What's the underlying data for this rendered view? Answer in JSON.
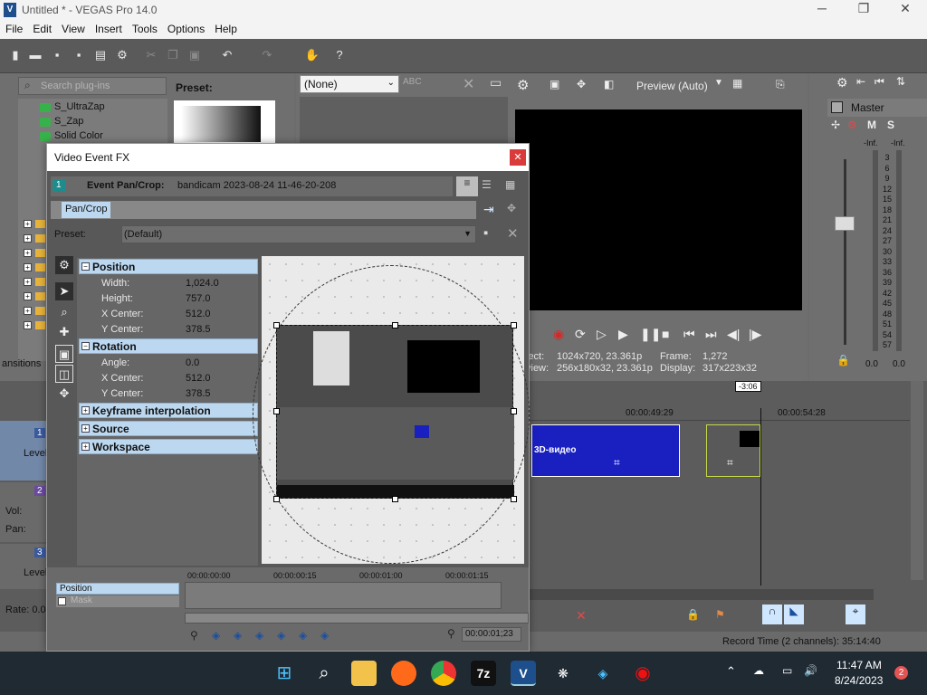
{
  "window": {
    "title": "Untitled * - VEGAS Pro 14.0"
  },
  "menu": [
    "File",
    "Edit",
    "View",
    "Insert",
    "Tools",
    "Options",
    "Help"
  ],
  "plugins": {
    "search_placeholder": "Search plug-ins",
    "preset_label": "Preset:",
    "items": [
      "S_UltraZap",
      "S_Zap",
      "Solid Color"
    ],
    "transitions_tab": "ansitions"
  },
  "fx_preset": {
    "value": "(None)"
  },
  "preview": {
    "mode": "Preview (Auto)",
    "project_label": "ject:",
    "project_value": "1024x720, 23.361p",
    "preview_label": "view:",
    "preview_value": "256x180x32, 23.361p",
    "frame_label": "Frame:",
    "frame_value": "1,272",
    "display_label": "Display:",
    "display_value": "317x223x32"
  },
  "mixer": {
    "title": "Master",
    "left_db": "-Inf.",
    "right_db": "-Inf.",
    "scale": [
      "3",
      "6",
      "9",
      "12",
      "15",
      "18",
      "21",
      "24",
      "27",
      "30",
      "33",
      "36",
      "39",
      "42",
      "45",
      "48",
      "51",
      "54",
      "57"
    ],
    "left_level": "0.0",
    "right_level": "0.0"
  },
  "dialog": {
    "title": "Video Event FX",
    "chain_num": "1",
    "event_label": "Event Pan/Crop:",
    "event_name": "bandicam 2023-08-24 11-46-20-208",
    "tab": "Pan/Crop",
    "preset_label": "Preset:",
    "preset_value": "(Default)",
    "sections": {
      "position": "Position",
      "rotation": "Rotation",
      "keyframe": "Keyframe interpolation",
      "source": "Source",
      "workspace": "Workspace"
    },
    "position_rows": [
      {
        "k": "Width:",
        "v": "1,024.0"
      },
      {
        "k": "Height:",
        "v": "757.0"
      },
      {
        "k": "X Center:",
        "v": "512.0"
      },
      {
        "k": "Y Center:",
        "v": "378.5"
      }
    ],
    "rotation_rows": [
      {
        "k": "Angle:",
        "v": "0.0"
      },
      {
        "k": "X Center:",
        "v": "512.0"
      },
      {
        "k": "Y Center:",
        "v": "378.5"
      }
    ],
    "keyframes": {
      "track_position": "Position",
      "track_mask": "Mask",
      "ticks": [
        "00:00:00:00",
        "00:00:00:15",
        "00:00:01:00",
        "00:00:01:15"
      ],
      "cursor_time": "00:00:01;23"
    }
  },
  "timeline": {
    "cursor": "-3:06",
    "ruler": [
      "00:00:49:29",
      "00:00:54:28"
    ],
    "tracks": [
      {
        "num": "1",
        "label": "Level"
      },
      {
        "num": "2",
        "vol": "Vol:",
        "pan": "Pan:"
      },
      {
        "num": "3",
        "label": "Level"
      }
    ],
    "clip_text": "3D-видео",
    "rate_label": "Rate: 0.0"
  },
  "status": {
    "record_time": "Record Time (2 channels): 35:14:40"
  },
  "taskbar": {
    "time": "11:47 AM",
    "date": "8/24/2023",
    "badge": "2"
  },
  "colors": {
    "accent": "#1565c0",
    "dialog_head": "#bcd8f0",
    "clip_blue": "#1a1fc0"
  }
}
